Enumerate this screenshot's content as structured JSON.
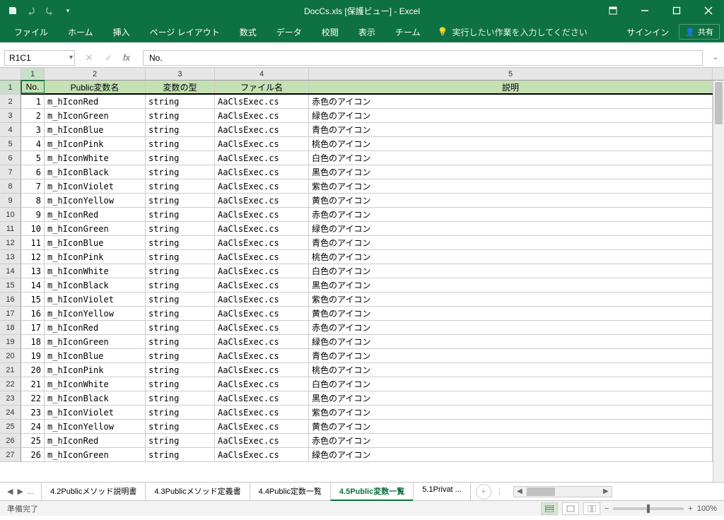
{
  "titlebar": {
    "title": "DocCs.xls [保護ビュー] - Excel"
  },
  "ribbon": {
    "tabs": [
      "ファイル",
      "ホーム",
      "挿入",
      "ページ レイアウト",
      "数式",
      "データ",
      "校閲",
      "表示",
      "チーム"
    ],
    "tell_me": "実行したい作業を入力してください",
    "signin": "サインイン",
    "share": "共有"
  },
  "formula_bar": {
    "name_box": "R1C1",
    "formula": "No."
  },
  "columns": [
    "1",
    "2",
    "3",
    "4",
    "5"
  ],
  "header_row": {
    "no": "No.",
    "name": "Public変数名",
    "type": "変数の型",
    "file": "ファイル名",
    "desc": "説明"
  },
  "rows": [
    {
      "no": "1",
      "name": "m_hIconRed",
      "type": "string",
      "file": "AaClsExec.cs",
      "desc": "赤色のアイコン"
    },
    {
      "no": "2",
      "name": "m_hIconGreen",
      "type": "string",
      "file": "AaClsExec.cs",
      "desc": "緑色のアイコン"
    },
    {
      "no": "3",
      "name": "m_hIconBlue",
      "type": "string",
      "file": "AaClsExec.cs",
      "desc": "青色のアイコン"
    },
    {
      "no": "4",
      "name": "m_hIconPink",
      "type": "string",
      "file": "AaClsExec.cs",
      "desc": "桃色のアイコン"
    },
    {
      "no": "5",
      "name": "m_hIconWhite",
      "type": "string",
      "file": "AaClsExec.cs",
      "desc": "白色のアイコン"
    },
    {
      "no": "6",
      "name": "m_hIconBlack",
      "type": "string",
      "file": "AaClsExec.cs",
      "desc": "黒色のアイコン"
    },
    {
      "no": "7",
      "name": "m_hIconViolet",
      "type": "string",
      "file": "AaClsExec.cs",
      "desc": "紫色のアイコン"
    },
    {
      "no": "8",
      "name": "m_hIconYellow",
      "type": "string",
      "file": "AaClsExec.cs",
      "desc": "黄色のアイコン"
    },
    {
      "no": "9",
      "name": "m_hIconRed",
      "type": "string",
      "file": "AaClsExec.cs",
      "desc": "赤色のアイコン"
    },
    {
      "no": "10",
      "name": "m_hIconGreen",
      "type": "string",
      "file": "AaClsExec.cs",
      "desc": "緑色のアイコン"
    },
    {
      "no": "11",
      "name": "m_hIconBlue",
      "type": "string",
      "file": "AaClsExec.cs",
      "desc": "青色のアイコン"
    },
    {
      "no": "12",
      "name": "m_hIconPink",
      "type": "string",
      "file": "AaClsExec.cs",
      "desc": "桃色のアイコン"
    },
    {
      "no": "13",
      "name": "m_hIconWhite",
      "type": "string",
      "file": "AaClsExec.cs",
      "desc": "白色のアイコン"
    },
    {
      "no": "14",
      "name": "m_hIconBlack",
      "type": "string",
      "file": "AaClsExec.cs",
      "desc": "黒色のアイコン"
    },
    {
      "no": "15",
      "name": "m_hIconViolet",
      "type": "string",
      "file": "AaClsExec.cs",
      "desc": "紫色のアイコン"
    },
    {
      "no": "16",
      "name": "m_hIconYellow",
      "type": "string",
      "file": "AaClsExec.cs",
      "desc": "黄色のアイコン"
    },
    {
      "no": "17",
      "name": "m_hIconRed",
      "type": "string",
      "file": "AaClsExec.cs",
      "desc": "赤色のアイコン"
    },
    {
      "no": "18",
      "name": "m_hIconGreen",
      "type": "string",
      "file": "AaClsExec.cs",
      "desc": "緑色のアイコン"
    },
    {
      "no": "19",
      "name": "m_hIconBlue",
      "type": "string",
      "file": "AaClsExec.cs",
      "desc": "青色のアイコン"
    },
    {
      "no": "20",
      "name": "m_hIconPink",
      "type": "string",
      "file": "AaClsExec.cs",
      "desc": "桃色のアイコン"
    },
    {
      "no": "21",
      "name": "m_hIconWhite",
      "type": "string",
      "file": "AaClsExec.cs",
      "desc": "白色のアイコン"
    },
    {
      "no": "22",
      "name": "m_hIconBlack",
      "type": "string",
      "file": "AaClsExec.cs",
      "desc": "黒色のアイコン"
    },
    {
      "no": "23",
      "name": "m_hIconViolet",
      "type": "string",
      "file": "AaClsExec.cs",
      "desc": "紫色のアイコン"
    },
    {
      "no": "24",
      "name": "m_hIconYellow",
      "type": "string",
      "file": "AaClsExec.cs",
      "desc": "黄色のアイコン"
    },
    {
      "no": "25",
      "name": "m_hIconRed",
      "type": "string",
      "file": "AaClsExec.cs",
      "desc": "赤色のアイコン"
    },
    {
      "no": "26",
      "name": "m_hIconGreen",
      "type": "string",
      "file": "AaClsExec.cs",
      "desc": "緑色のアイコン"
    }
  ],
  "visible_row_numbers": [
    "1",
    "2",
    "3",
    "4",
    "5",
    "6",
    "7",
    "8",
    "9",
    "10",
    "11",
    "12",
    "13",
    "14",
    "15",
    "16",
    "17",
    "18",
    "19",
    "20",
    "21",
    "22",
    "23",
    "24",
    "25",
    "26",
    "27"
  ],
  "sheet_tabs": {
    "prev_overflow": "...",
    "tabs": [
      {
        "label": "4.2Publicメソッド説明書",
        "active": false
      },
      {
        "label": "4.3Publicメソッド定義書",
        "active": false
      },
      {
        "label": "4.4Public定数一覧",
        "active": false
      },
      {
        "label": "4.5Public変数一覧",
        "active": true
      },
      {
        "label": "5.1Privat ...",
        "active": false
      }
    ]
  },
  "status": {
    "left": "準備完了",
    "zoom": "100%"
  }
}
